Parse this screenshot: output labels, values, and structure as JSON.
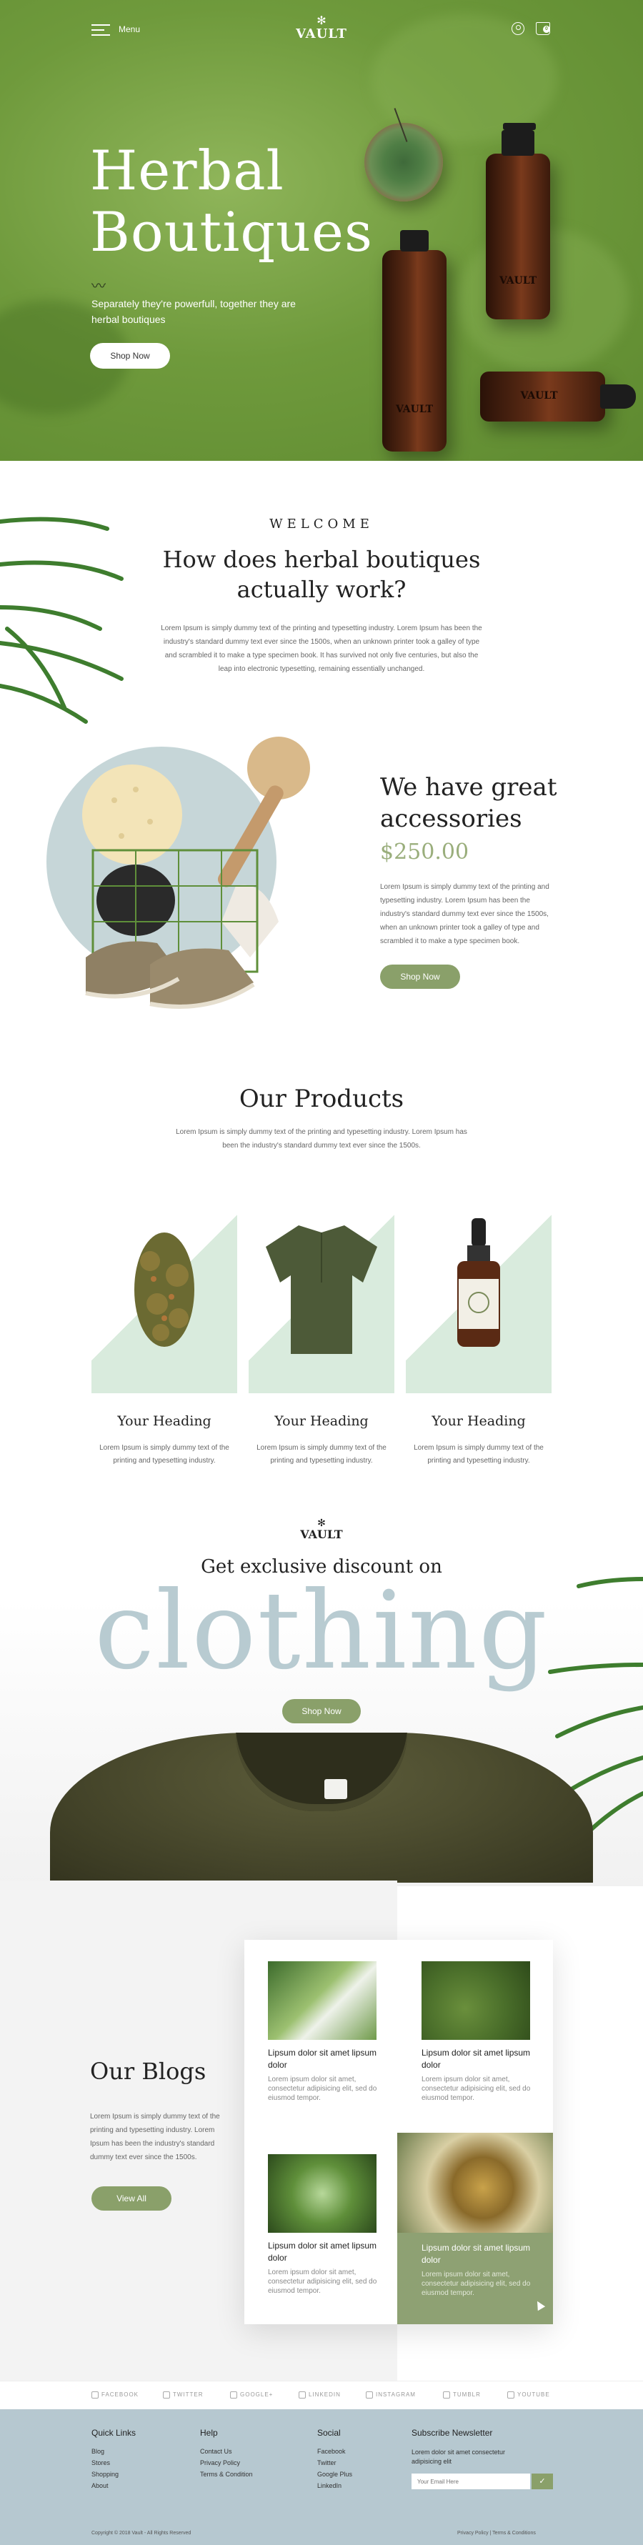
{
  "nav": {
    "menu_label": "Menu",
    "logo_text": "VAULT",
    "cart_count": "0"
  },
  "hero": {
    "title_line1": "Herbal",
    "title_line2": "Boutiques",
    "subtitle": "Separately they're powerfull, together they are herbal boutiques",
    "button": "Shop Now",
    "bottle_label": "VAULT"
  },
  "welcome": {
    "eyebrow": "WELCOME",
    "title_line1": "How does herbal boutiques",
    "title_line2": "actually work?",
    "text": "Lorem Ipsum is simply dummy text of the printing and typesetting industry. Lorem Ipsum has been the industry's standard dummy text ever since the 1500s, when an unknown printer took a galley of type and scrambled it to make a type specimen book. It has survived not only five centuries, but also the leap into electronic typesetting, remaining essentially unchanged."
  },
  "accessories": {
    "title_line1": "We have great",
    "title_line2": "accessories",
    "price": "$250.00",
    "text": "Lorem Ipsum is simply dummy text of the printing and typesetting industry. Lorem Ipsum has been the industry's standard dummy text ever since the 1500s, when an unknown printer took a galley of type and scrambled it to make a type specimen book.",
    "button": "Shop Now"
  },
  "products": {
    "title": "Our Products",
    "text": "Lorem Ipsum is simply dummy text of the printing and typesetting industry. Lorem Ipsum has been the industry's standard dummy text ever since the 1500s.",
    "items": [
      {
        "heading": "Your Heading",
        "text": "Lorem Ipsum is simply dummy text of the printing and typesetting industry."
      },
      {
        "heading": "Your Heading",
        "text": "Lorem Ipsum is simply dummy text of the printing and typesetting industry."
      },
      {
        "heading": "Your Heading",
        "text": "Lorem Ipsum is simply dummy text of the printing and typesetting industry."
      }
    ]
  },
  "discount": {
    "logo_text": "VAULT",
    "title": "Get exclusive discount on",
    "big_word": "clothing",
    "button": "Shop Now"
  },
  "blogs": {
    "title": "Our Blogs",
    "text": "Lorem Ipsum is simply dummy text of the printing and typesetting industry. Lorem Ipsum has been the industry's standard dummy text ever since the 1500s.",
    "button": "View All",
    "cards": [
      {
        "title": "Lipsum dolor sit amet lipsum dolor",
        "text": "Lorem ipsum dolor sit amet, consectetur adipisicing elit, sed do eiusmod tempor."
      },
      {
        "title": "Lipsum dolor sit amet lipsum dolor",
        "text": "Lorem ipsum dolor sit amet, consectetur adipisicing elit, sed do eiusmod tempor."
      },
      {
        "title": "Lipsum dolor sit amet lipsum dolor",
        "text": "Lorem ipsum dolor sit amet, consectetur adipisicing elit, sed do eiusmod tempor."
      },
      {
        "title": "Lipsum dolor sit amet lipsum dolor",
        "text": "Lorem ipsum dolor sit amet, consectetur adipisicing elit, sed do eiusmod tempor."
      }
    ]
  },
  "social": [
    "FACEBOOK",
    "TWITTER",
    "GOOGLE+",
    "LINKEDIN",
    "INSTAGRAM",
    "TUMBLR",
    "YOUTUBE"
  ],
  "footer": {
    "quick_links": {
      "heading": "Quick Links",
      "items": [
        "Blog",
        "Stores",
        "Shopping",
        "About"
      ]
    },
    "help": {
      "heading": "Help",
      "items": [
        "Contact Us",
        "Privacy Policy",
        "Terms & Condition"
      ]
    },
    "social": {
      "heading": "Social",
      "items": [
        "Facebook",
        "Twitter",
        "Google Plus",
        "LinkedIn"
      ]
    },
    "newsletter": {
      "heading": "Subscribe Newsletter",
      "text": "Lorem dolor sit amet consectetur adipisicing elit",
      "placeholder": "Your Email Here"
    },
    "copyright": "Copyright © 2018 Vault - All Rights Reserved",
    "bottom_links": "Privacy Policy  |  Terms & Conditions"
  },
  "colors": {
    "hero_green": "#6f9a3c",
    "accent_green": "#8aa06a",
    "price_green": "#9aae7c",
    "mint": "#d9ebdd",
    "clothing_blue": "#b8cbd1",
    "footer_blue": "#b6c8d0"
  }
}
